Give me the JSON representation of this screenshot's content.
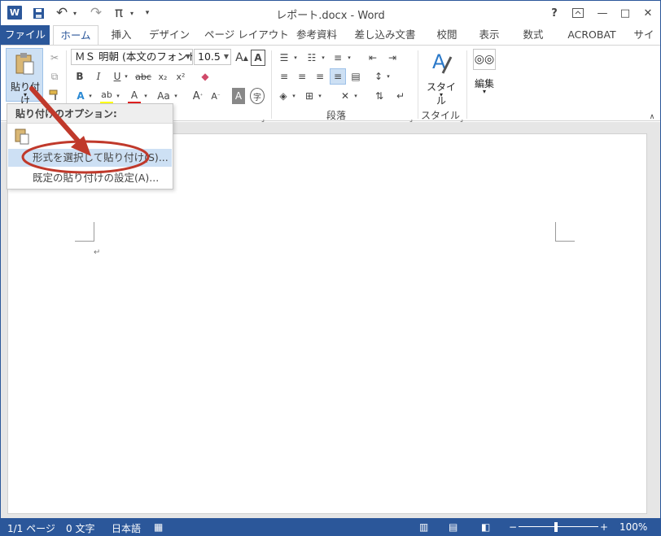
{
  "window": {
    "title": "レポート.docx - Word",
    "help": "?",
    "minimize": "—",
    "maximize": "□",
    "close": "✕",
    "logo": "W"
  },
  "qat": {
    "save_icon": "save-icon",
    "undo": "↶",
    "redo": "↷",
    "equation": "π"
  },
  "tabs": [
    {
      "label": "ファイル"
    },
    {
      "label": "ホーム"
    },
    {
      "label": "挿入"
    },
    {
      "label": "デザイン"
    },
    {
      "label": "ページ レイアウト"
    },
    {
      "label": "参考資料"
    },
    {
      "label": "差し込み文書"
    },
    {
      "label": "校閲"
    },
    {
      "label": "表示"
    },
    {
      "label": "数式"
    },
    {
      "label": "ACROBAT"
    },
    {
      "label": "サイ"
    }
  ],
  "ribbon": {
    "paste_label": "貼り付け",
    "font_name": "ＭＳ 明朝 (本文のフォント",
    "font_size": "10.5",
    "style_label": "スタイル",
    "edit_label": "編集",
    "groups": {
      "paragraph": "段落",
      "styles": "スタイル"
    }
  },
  "paste_menu": {
    "header": "貼り付けのオプション:",
    "items": [
      {
        "label": "形式を選択して貼り付け(S)..."
      },
      {
        "label": "既定の貼り付けの設定(A)..."
      }
    ]
  },
  "status": {
    "page": "1/1 ページ",
    "words": "0 文字",
    "language": "日本語",
    "zoom": "100%"
  },
  "colors": {
    "accent": "#2b579a",
    "highlight": "#cde0f4",
    "annotation": "#c0392b"
  }
}
